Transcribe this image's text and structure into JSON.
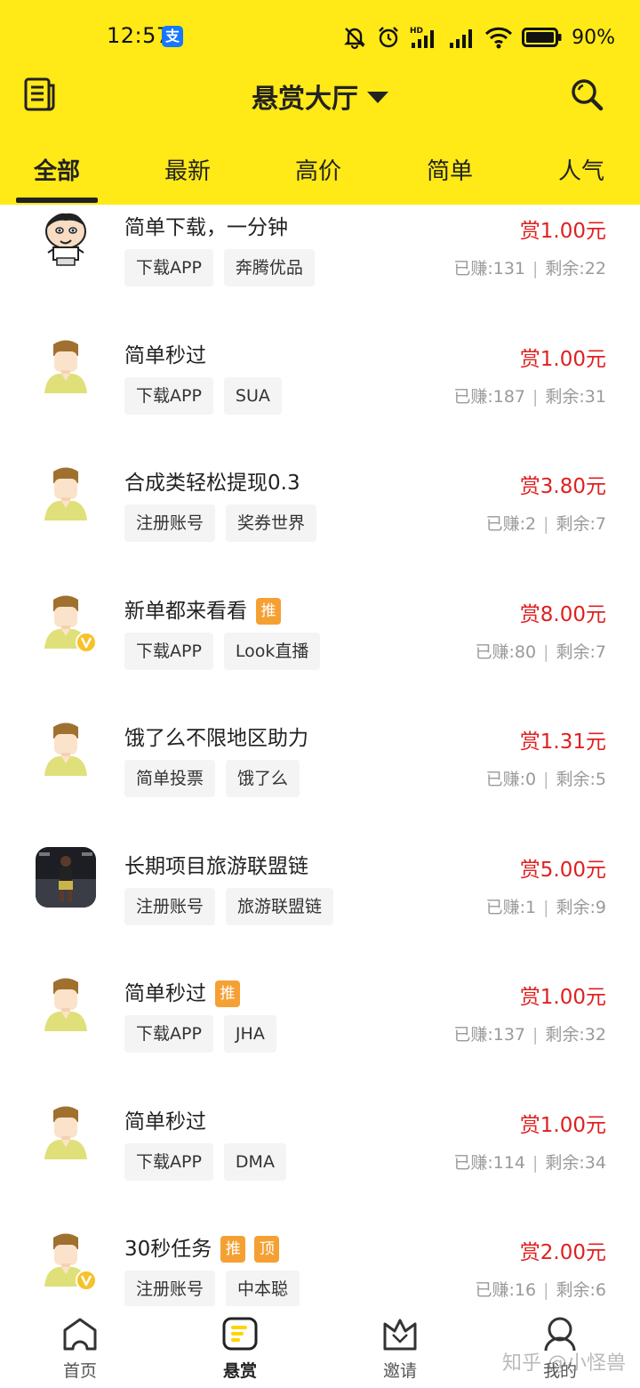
{
  "status_bar": {
    "time": "12:57",
    "alipay_label": "支",
    "battery": "90%"
  },
  "header": {
    "title": "悬赏大厅"
  },
  "tabs": [
    {
      "label": "全部",
      "active": true
    },
    {
      "label": "最新",
      "active": false
    },
    {
      "label": "高价",
      "active": false
    },
    {
      "label": "简单",
      "active": false
    },
    {
      "label": "人气",
      "active": false
    }
  ],
  "tasks": [
    {
      "title": "简单下载，一分钟",
      "flags": [],
      "tags": [
        "下载APP",
        "奔腾优品"
      ],
      "reward": "赏1.00元",
      "earned": "已赚:131",
      "remaining": "剩余:22",
      "avatar": "cartoon"
    },
    {
      "title": "简单秒过",
      "flags": [],
      "tags": [
        "下载APP",
        "SUA"
      ],
      "reward": "赏1.00元",
      "earned": "已赚:187",
      "remaining": "剩余:31",
      "avatar": "default"
    },
    {
      "title": "合成类轻松提现0.3",
      "flags": [],
      "tags": [
        "注册账号",
        "奖券世界"
      ],
      "reward": "赏3.80元",
      "earned": "已赚:2",
      "remaining": "剩余:7",
      "avatar": "default"
    },
    {
      "title": "新单都来看看",
      "flags": [
        "推"
      ],
      "tags": [
        "下载APP",
        "Look直播"
      ],
      "reward": "赏8.00元",
      "earned": "已赚:80",
      "remaining": "剩余:7",
      "avatar": "vip"
    },
    {
      "title": "饿了么不限地区助力",
      "flags": [],
      "tags": [
        "简单投票",
        "饿了么"
      ],
      "reward": "赏1.31元",
      "earned": "已赚:0",
      "remaining": "剩余:5",
      "avatar": "default"
    },
    {
      "title": "长期项目旅游联盟链",
      "flags": [],
      "tags": [
        "注册账号",
        "旅游联盟链"
      ],
      "reward": "赏5.00元",
      "earned": "已赚:1",
      "remaining": "剩余:9",
      "avatar": "photo"
    },
    {
      "title": "简单秒过",
      "flags": [
        "推"
      ],
      "tags": [
        "下载APP",
        "JHA"
      ],
      "reward": "赏1.00元",
      "earned": "已赚:137",
      "remaining": "剩余:32",
      "avatar": "default"
    },
    {
      "title": "简单秒过",
      "flags": [],
      "tags": [
        "下载APP",
        "DMA"
      ],
      "reward": "赏1.00元",
      "earned": "已赚:114",
      "remaining": "剩余:34",
      "avatar": "default"
    },
    {
      "title": "30秒任务",
      "flags": [
        "推",
        "顶"
      ],
      "tags": [
        "注册账号",
        "中本聪"
      ],
      "reward": "赏2.00元",
      "earned": "已赚:16",
      "remaining": "剩余:6",
      "avatar": "vip"
    }
  ],
  "bottom_nav": [
    {
      "label": "首页",
      "icon": "home-icon",
      "active": false
    },
    {
      "label": "悬赏",
      "icon": "reward-icon",
      "active": true
    },
    {
      "label": "邀请",
      "icon": "invite-icon",
      "active": false
    },
    {
      "label": "我的",
      "icon": "profile-icon",
      "active": false
    }
  ],
  "watermark": "知乎 @小怪兽",
  "colors": {
    "header_bg": "#ffe916",
    "reward": "#e02020",
    "flag": "#f5a033"
  }
}
